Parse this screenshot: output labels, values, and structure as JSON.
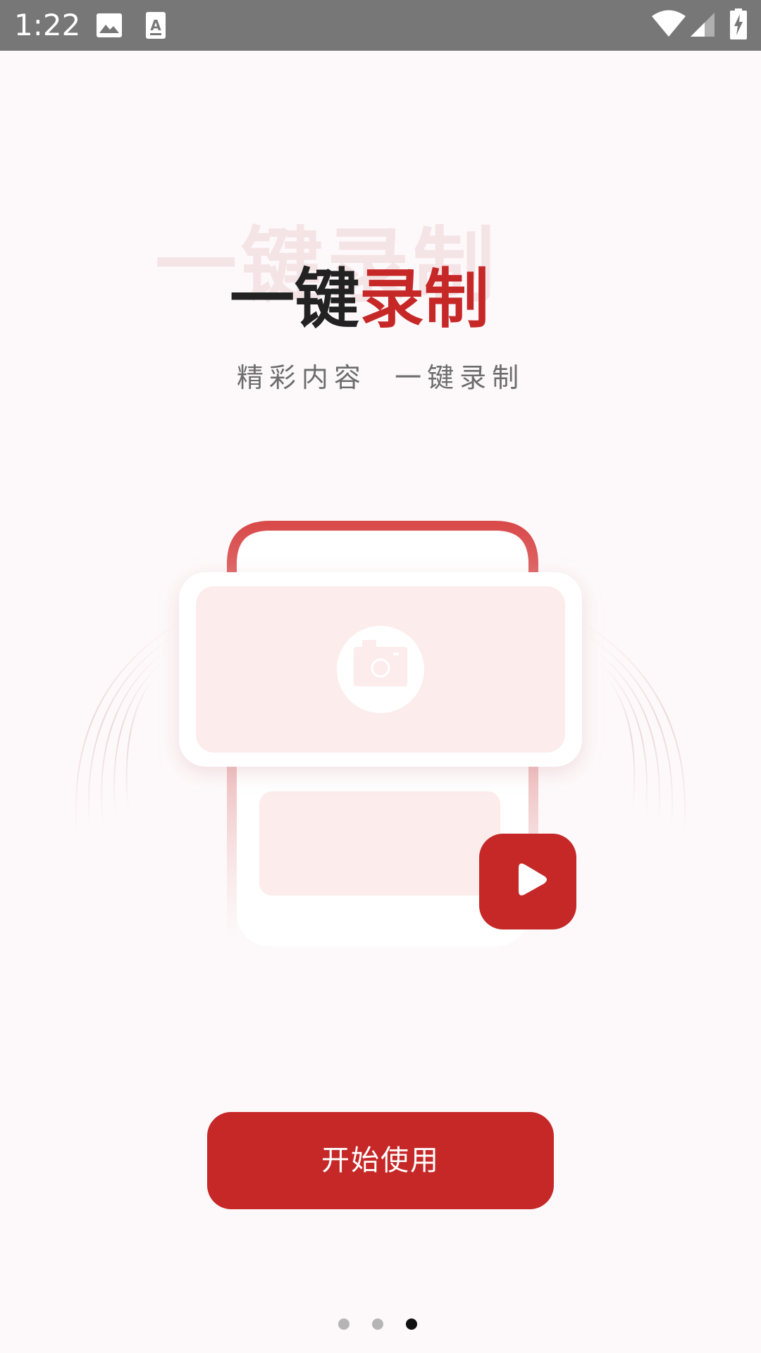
{
  "status_bar": {
    "time": "1:22",
    "icons": [
      "image-icon",
      "keyboard-a-icon",
      "wifi-icon",
      "signal-icon",
      "battery-charging-icon"
    ]
  },
  "headline": {
    "shadow_text": "一键录制",
    "dark_part": "一键",
    "red_part": "录制"
  },
  "subtitle": "精彩内容  一键录制",
  "illustration": {
    "icons": [
      "camera-icon",
      "play-icon"
    ]
  },
  "start_button": {
    "label": "开始使用"
  },
  "page_indicator": {
    "count": 3,
    "active_index": 2
  },
  "colors": {
    "accent": "#c62828",
    "status_bar": "#777777",
    "background": "#fdf9fa",
    "pink_fill": "#fcecec"
  }
}
